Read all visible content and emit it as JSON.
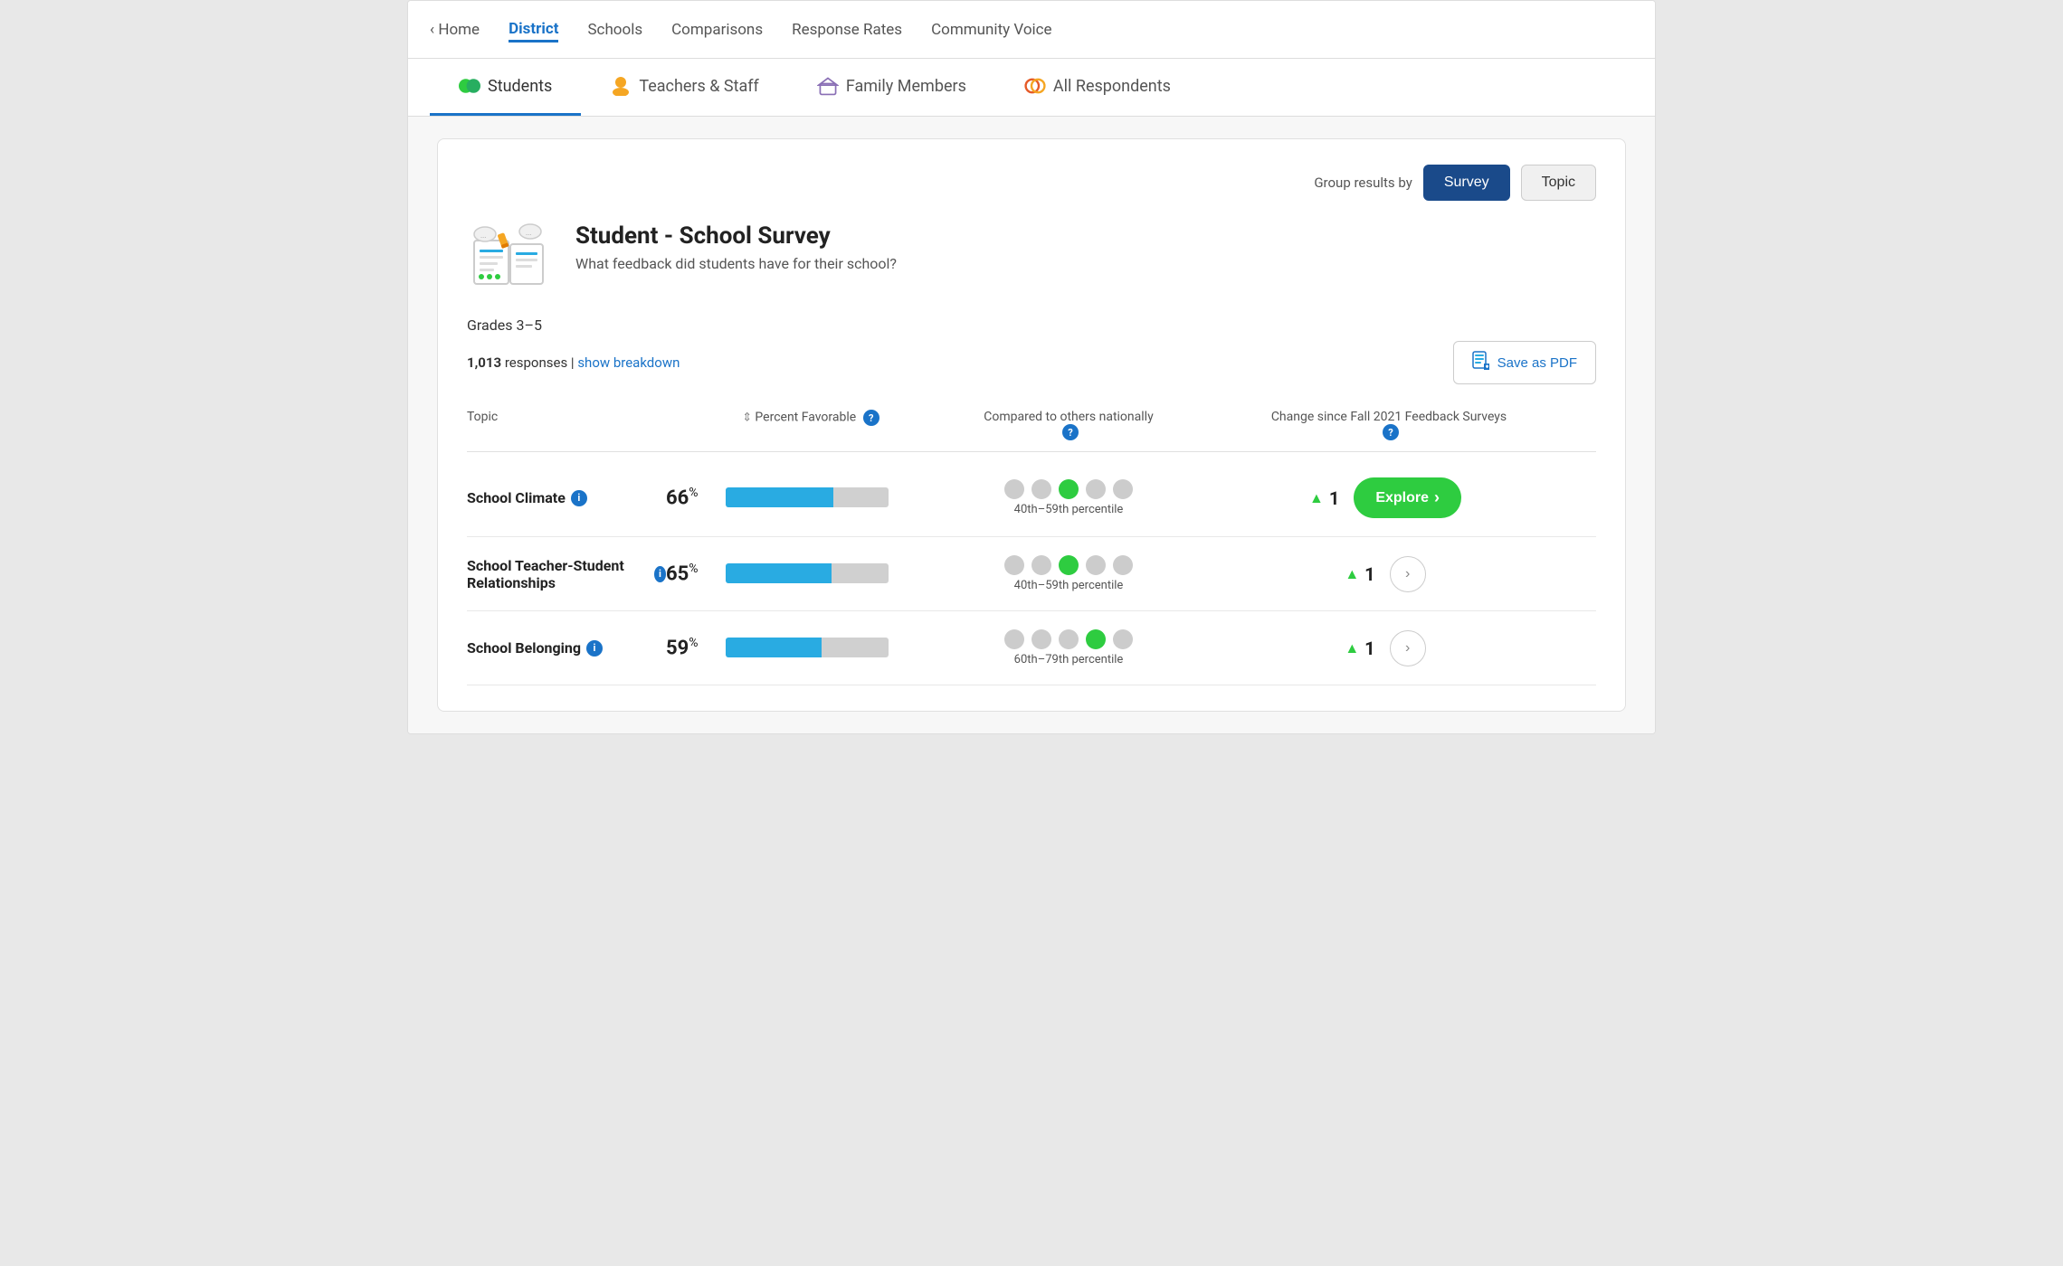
{
  "nav": {
    "home": "Home",
    "items": [
      {
        "label": "District",
        "active": true
      },
      {
        "label": "Schools",
        "active": false
      },
      {
        "label": "Comparisons",
        "active": false
      },
      {
        "label": "Response Rates",
        "active": false
      },
      {
        "label": "Community Voice",
        "active": false
      }
    ]
  },
  "tabs": [
    {
      "id": "students",
      "label": "Students",
      "active": true,
      "icon": "students-icon"
    },
    {
      "id": "teachers",
      "label": "Teachers & Staff",
      "active": false,
      "icon": "teachers-icon"
    },
    {
      "id": "family",
      "label": "Family Members",
      "active": false,
      "icon": "family-icon"
    },
    {
      "id": "all",
      "label": "All Respondents",
      "active": false,
      "icon": "all-icon"
    }
  ],
  "group_results": {
    "label": "Group results by",
    "options": [
      {
        "label": "Survey",
        "active": true
      },
      {
        "label": "Topic",
        "active": false
      }
    ]
  },
  "survey": {
    "title": "Student - School Survey",
    "subtitle": "What feedback did students have for their school?",
    "grades": "Grades 3–5",
    "responses_count": "1,013",
    "responses_label": "responses",
    "show_breakdown": "show breakdown",
    "save_pdf": "Save as PDF"
  },
  "table": {
    "columns": [
      {
        "label": "Topic",
        "id": "topic"
      },
      {
        "label": "Percent Favorable",
        "id": "percent",
        "sortable": true,
        "help": true
      },
      {
        "label": "Compared to others nationally",
        "id": "national",
        "help": true
      },
      {
        "label": "Change since Fall 2021 Feedback Surveys",
        "id": "change",
        "help": true
      }
    ],
    "rows": [
      {
        "topic": "School Climate",
        "info": true,
        "percent": 66,
        "bar_fill": 66,
        "percentile_label": "40th–59th percentile",
        "percentile_position": 3,
        "change": 1,
        "explore": true
      },
      {
        "topic": "School Teacher-Student Relationships",
        "info": true,
        "percent": 65,
        "bar_fill": 65,
        "percentile_label": "40th–59th percentile",
        "percentile_position": 3,
        "change": 1,
        "explore": false
      },
      {
        "topic": "School Belonging",
        "info": true,
        "percent": 59,
        "bar_fill": 59,
        "percentile_label": "60th–79th percentile",
        "percentile_position": 4,
        "change": 1,
        "explore": false
      }
    ]
  }
}
